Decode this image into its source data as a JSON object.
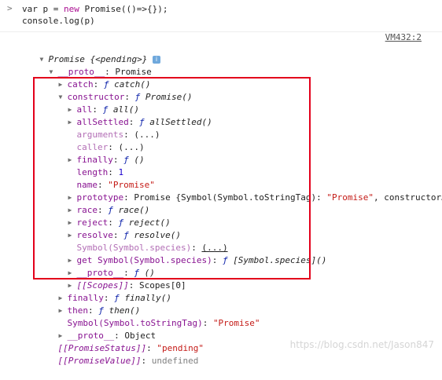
{
  "prompt": {
    "line1_prefix": "var p = ",
    "line1_keyword": "new",
    "line1_suffix": " Promise(()=>{});",
    "line2": "console.log(p)"
  },
  "source_link": "VM432:2",
  "tree": {
    "root": {
      "name": "Promise",
      "state": " {<pending>}"
    },
    "proto": {
      "key": "__proto__",
      "value": "Promise"
    },
    "catch": {
      "key": "catch",
      "f": "ƒ",
      "name": "catch()"
    },
    "constructor": {
      "key": "constructor",
      "f": "ƒ",
      "name": "Promise()"
    },
    "ctor_children": {
      "all": {
        "key": "all",
        "f": "ƒ",
        "name": "all()"
      },
      "allSettled": {
        "key": "allSettled",
        "f": "ƒ",
        "name": "allSettled()"
      },
      "arguments": {
        "key": "arguments",
        "value": "(...)"
      },
      "caller": {
        "key": "caller",
        "value": "(...)"
      },
      "finally": {
        "key": "finally",
        "f": "ƒ",
        "name": "()"
      },
      "length": {
        "key": "length",
        "value": "1"
      },
      "name": {
        "key": "name",
        "value": "\"Promise\""
      },
      "prototype": {
        "key": "prototype",
        "value_prefix": "Promise {Symbol(Symbol.toStringTag): ",
        "value_string": "\"Promise\"",
        "value_suffix": ", constructor…"
      },
      "race": {
        "key": "race",
        "f": "ƒ",
        "name": "race()"
      },
      "reject": {
        "key": "reject",
        "f": "ƒ",
        "name": "reject()"
      },
      "resolve": {
        "key": "resolve",
        "f": "ƒ",
        "name": "resolve()"
      },
      "species": {
        "key": "Symbol(Symbol.species)",
        "value": "(...)"
      },
      "get_species": {
        "key": "get Symbol(Symbol.species)",
        "f": "ƒ",
        "name": "[Symbol.species]()"
      },
      "ctor_proto": {
        "key": "__proto__",
        "f": "ƒ",
        "name": "()"
      },
      "scopes": {
        "key": "[[Scopes]]",
        "value": "Scopes[0]"
      }
    },
    "finally": {
      "key": "finally",
      "f": "ƒ",
      "name": "finally()"
    },
    "then": {
      "key": "then",
      "f": "ƒ",
      "name": "then()"
    },
    "toStringTag": {
      "key": "Symbol(Symbol.toStringTag)",
      "value": "\"Promise\""
    },
    "proto_object": {
      "key": "__proto__",
      "value": "Object"
    },
    "status": {
      "key": "[[PromiseStatus]]",
      "value": "\"pending\""
    },
    "value": {
      "key": "[[PromiseValue]]",
      "value": "undefined"
    }
  },
  "watermark": "https://blog.csdn.net/Jason847",
  "colors": {
    "highlight": "#e3001b",
    "key": "#881391",
    "string": "#c41a16",
    "number": "#1c00cf",
    "function_keyword": "#0d22aa"
  },
  "icons": {
    "prompt": "chevron-right-icon",
    "expanded": "triangle-down-icon",
    "collapsed": "triangle-right-icon",
    "info": "info-icon"
  }
}
